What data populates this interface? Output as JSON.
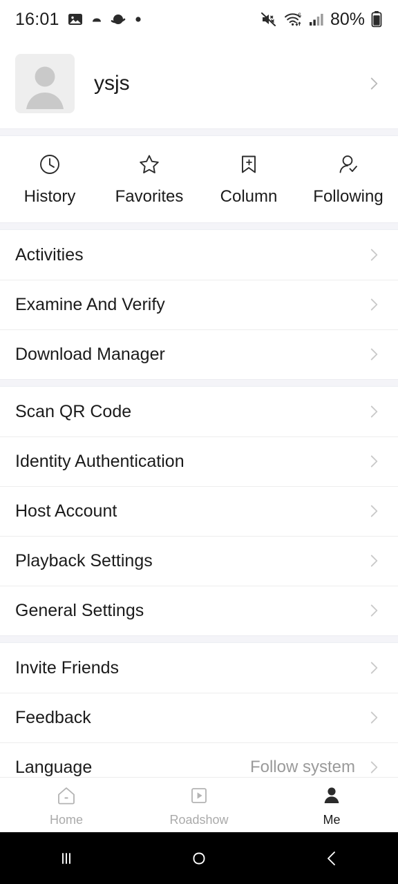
{
  "status_bar": {
    "time": "16:01",
    "battery_percent": "80%",
    "left_icons": [
      "image-icon",
      "small-shape-icon",
      "saturn-icon",
      "dot-icon"
    ],
    "right_icons": [
      "mute-icon",
      "wifi-6-icon",
      "signal-bars-icon",
      "battery-icon"
    ]
  },
  "profile": {
    "username": "ysjs",
    "avatar_icon": "default-avatar-icon",
    "chevron_icon": "chevron-right-icon"
  },
  "quick_actions": [
    {
      "label": "History",
      "icon": "clock-icon"
    },
    {
      "label": "Favorites",
      "icon": "star-icon"
    },
    {
      "label": "Column",
      "icon": "bookmark-plus-icon"
    },
    {
      "label": "Following",
      "icon": "person-check-icon"
    }
  ],
  "groups": [
    {
      "rows": [
        {
          "label": "Activities",
          "value": ""
        },
        {
          "label": "Examine And Verify",
          "value": ""
        },
        {
          "label": "Download Manager",
          "value": ""
        }
      ]
    },
    {
      "rows": [
        {
          "label": "Scan QR Code",
          "value": ""
        },
        {
          "label": "Identity Authentication",
          "value": ""
        },
        {
          "label": "Host Account",
          "value": ""
        },
        {
          "label": "Playback Settings",
          "value": ""
        },
        {
          "label": "General Settings",
          "value": ""
        }
      ]
    },
    {
      "rows": [
        {
          "label": "Invite Friends",
          "value": ""
        },
        {
          "label": "Feedback",
          "value": ""
        },
        {
          "label": "Language",
          "value": "Follow system"
        }
      ]
    }
  ],
  "tab_bar": {
    "tabs": [
      {
        "label": "Home",
        "icon": "home-icon",
        "active": false
      },
      {
        "label": "Roadshow",
        "icon": "play-square-icon",
        "active": false
      },
      {
        "label": "Me",
        "icon": "person-filled-icon",
        "active": true
      }
    ]
  },
  "nav_bar": {
    "buttons": [
      "recents-icon",
      "home-circle-icon",
      "back-icon"
    ]
  },
  "colors": {
    "background": "#ffffff",
    "spacer": "#f4f4f8",
    "text_primary": "#1b1b1b",
    "text_muted": "#9a9a9a",
    "divider": "#ededed",
    "chevron": "#c9c9c9",
    "navbar": "#000000"
  }
}
